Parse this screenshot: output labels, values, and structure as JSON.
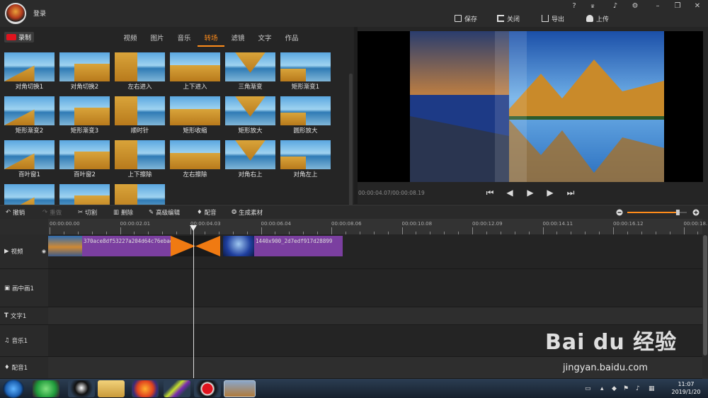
{
  "titlebar": {
    "login": "登录",
    "window_buttons": [
      "?",
      "VIP",
      "bell",
      "gear",
      "minimize",
      "restore",
      "close"
    ]
  },
  "actions": {
    "save": "保存",
    "close": "关闭",
    "export": "导出",
    "upload": "上传"
  },
  "left": {
    "record": "录制",
    "tabs": [
      "视频",
      "图片",
      "音乐",
      "转场",
      "滤镜",
      "文字",
      "作品"
    ],
    "active_tab": "转场",
    "transitions": [
      "对角切换1",
      "对角切换2",
      "左右进入",
      "上下进入",
      "三角渐变",
      "矩形渐变1",
      "矩形渐变2",
      "矩形渐变3",
      "顺时针",
      "矩形收缩",
      "矩形放大",
      "圆形放大",
      "百叶窗1",
      "百叶窗2",
      "上下擦除",
      "左右擦除",
      "对角右上",
      "对角左上",
      "",
      "",
      ""
    ]
  },
  "preview": {
    "timecode": "00:00:04.07/00:00:08.19"
  },
  "toolbar": {
    "undo": "撤销",
    "redo": "重做",
    "cut": "切割",
    "delete": "删除",
    "advanced": "高级编辑",
    "dub": "配音",
    "generate": "生成素材",
    "zoom_level": 0.85
  },
  "ruler": [
    "00:00:00.00",
    "00:00:02.01",
    "00:00:04.03",
    "00:00:06.04",
    "00:00:08.06",
    "00:00:10.08",
    "00:00:12.09",
    "00:00:14.11",
    "00:00:16.12",
    "00:00:18."
  ],
  "tracks": {
    "video": "视频",
    "pip": "画中画1",
    "text": "文字1",
    "music": "音乐1",
    "voice": "配音1"
  },
  "clips": {
    "clip1": "370ace8df53227a204d64c76ebad",
    "clip2": "1440x900_2d7edf917d28899"
  },
  "taskbar": {
    "time": "11:07",
    "date": "2019/1/20"
  },
  "watermark": {
    "brand": "Bai du 经验",
    "url": "jingyan.baidu.com"
  },
  "colors": {
    "accent": "#ff8c1a",
    "clip": "#7b3fa0",
    "record": "#e0141e"
  }
}
